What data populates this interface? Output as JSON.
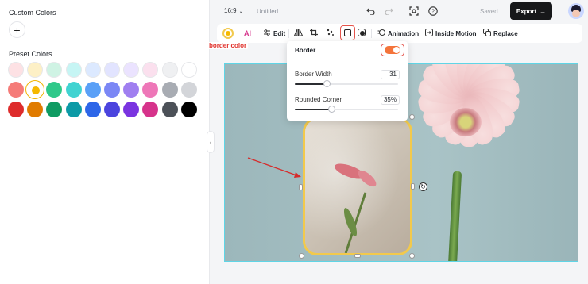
{
  "left_panel": {
    "custom_title": "Custom Colors",
    "add_label": "+",
    "preset_title": "Preset Colors",
    "preset_colors": [
      "#fde1e4",
      "#fdf0c6",
      "#cff3e4",
      "#c6f5f4",
      "#dce9ff",
      "#e2e4ff",
      "#ebe3ff",
      "#fbe0ee",
      "#eff0f2",
      "#ffffff",
      "#f57b78",
      "#f5b800",
      "#2fc98a",
      "#41d3d1",
      "#5aa0f7",
      "#7b87f5",
      "#a07ff0",
      "#ee77b8",
      "#a8acb3",
      "#d3d5d9",
      "#de2c2c",
      "#e07b00",
      "#0f9b62",
      "#0c9aa6",
      "#2d66e8",
      "#4b44de",
      "#7a34e0",
      "#d6338b",
      "#4c5158",
      "#000000"
    ],
    "selected_color": "#f5b800"
  },
  "topbar": {
    "ratio": "16:9",
    "doc_title": "Untitled",
    "saved": "Saved",
    "export": "Export",
    "export_arrow": "→"
  },
  "toolbar": {
    "edit": "Edit",
    "animation": "Animation",
    "inside_motion": "Inside Motion",
    "replace": "Replace",
    "ai": "AI"
  },
  "annotation": {
    "label": "border color",
    "accent": "#e0312b"
  },
  "border_popup": {
    "title": "Border",
    "toggle_on": true,
    "width_label": "Border Width",
    "width_value": "31",
    "width_fraction": 0.31,
    "corner_label": "Rounded Corner",
    "corner_value": "35%",
    "corner_fraction": 0.35
  },
  "colors": {
    "border": "#f2c94c",
    "canvas_outline": "#5fd5e6",
    "toggle": "#f4743b"
  }
}
